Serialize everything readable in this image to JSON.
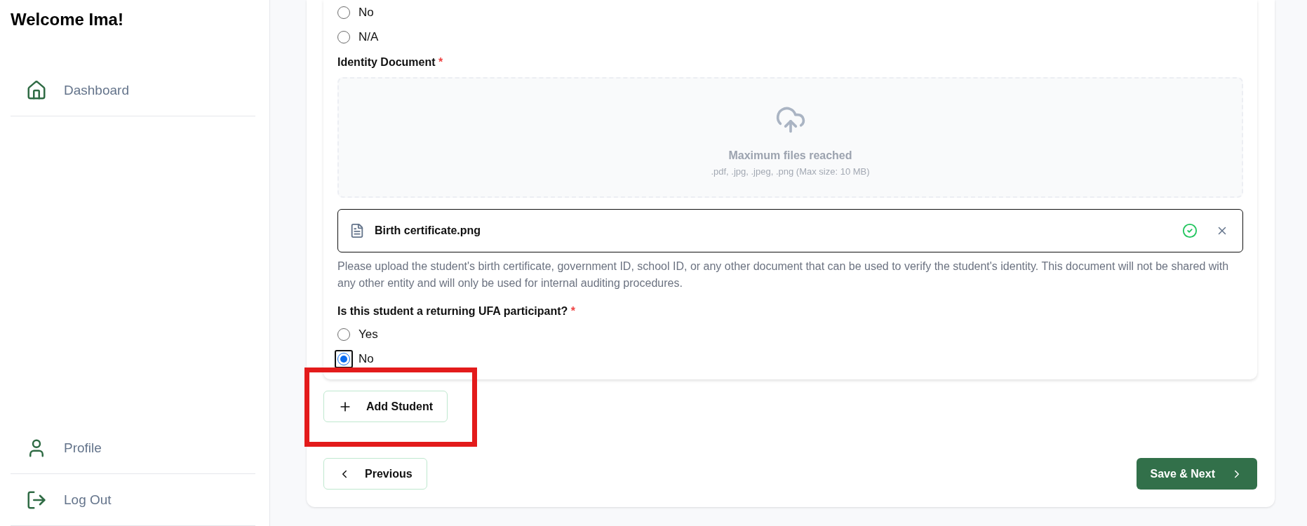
{
  "sidebar": {
    "greeting": "Welcome Ima!",
    "top_items": [
      {
        "label": "Dashboard",
        "kind": "home"
      }
    ],
    "bottom_items": [
      {
        "label": "Profile",
        "kind": "user"
      },
      {
        "label": "Log Out",
        "kind": "logout"
      }
    ]
  },
  "form": {
    "prior_options": [
      {
        "label": "No",
        "selected": false,
        "focused": false
      },
      {
        "label": "N/A",
        "selected": false,
        "focused": false
      }
    ],
    "identity_document": {
      "label": "Identity Document",
      "required_mark": "*",
      "dropzone": {
        "title": "Maximum files reached",
        "formats": ".pdf, .jpg, .jpeg, .png (Max size: 10 MB)"
      },
      "files": [
        {
          "name": "Birth certificate.png",
          "uploaded": true
        }
      ],
      "help": "Please upload the student's birth certificate, government ID, school ID, or any other document that can be used to verify the student's identity. This document will not be shared with any other entity and will only be used for internal auditing procedures."
    },
    "returning_question": {
      "label": "Is this student a returning UFA participant?",
      "required_mark": "*",
      "options": [
        {
          "label": "Yes",
          "selected": false,
          "focused": false
        },
        {
          "label": "No",
          "selected": true,
          "focused": true
        }
      ]
    }
  },
  "add_student_button": {
    "label": "Add Student",
    "highlighted": true
  },
  "nav": {
    "previous": "Previous",
    "next": "Save & Next"
  }
}
